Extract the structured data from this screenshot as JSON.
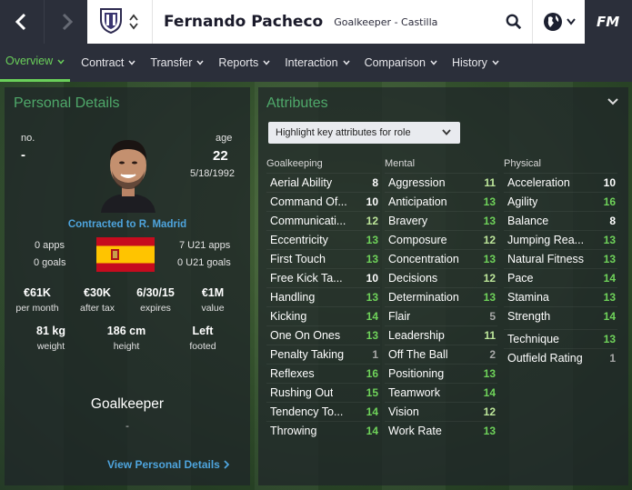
{
  "header": {
    "player_name": "Fernando Pacheco",
    "player_sub": "Goalkeeper - Castilla",
    "logo": "FM"
  },
  "menu": [
    {
      "label": "Overview",
      "active": true
    },
    {
      "label": "Contract",
      "active": false
    },
    {
      "label": "Transfer",
      "active": false
    },
    {
      "label": "Reports",
      "active": false
    },
    {
      "label": "Interaction",
      "active": false
    },
    {
      "label": "Comparison",
      "active": false
    },
    {
      "label": "History",
      "active": false
    }
  ],
  "personal": {
    "title": "Personal Details",
    "no_label": "no.",
    "no_value": "-",
    "age_label": "age",
    "age_value": "22",
    "dob": "5/18/1992",
    "contracted": "Contracted to R. Madrid",
    "apps": "0 apps",
    "goals": "0 goals",
    "u21_apps": "7 U21 apps",
    "u21_goals": "0 U21 goals",
    "wage_value": "€61K",
    "wage_label": "per month",
    "after_tax_value": "€30K",
    "after_tax_label": "after tax",
    "expires_value": "6/30/15",
    "expires_label": "expires",
    "value_value": "€1M",
    "value_label": "value",
    "weight_value": "81 kg",
    "weight_label": "weight",
    "height_value": "186 cm",
    "height_label": "height",
    "foot_value": "Left",
    "foot_label": "footed",
    "position": "Goalkeeper",
    "position_sub": "-",
    "view_link": "View Personal Details"
  },
  "attributes": {
    "title": "Attributes",
    "highlight": "Highlight key attributes for role",
    "colors": {
      "high": "#6fd35a",
      "mid": "#bde69a",
      "low": "#a8a8a8",
      "white": "#ffffff"
    },
    "columns": [
      {
        "heading": "Goalkeeping",
        "rows": [
          {
            "name": "Aerial Ability",
            "value": "8"
          },
          {
            "name": "Command Of...",
            "value": "10"
          },
          {
            "name": "Communicati...",
            "value": "12"
          },
          {
            "name": "Eccentricity",
            "value": "13"
          },
          {
            "name": "First Touch",
            "value": "13"
          },
          {
            "name": "Free Kick Ta...",
            "value": "10"
          },
          {
            "name": "Handling",
            "value": "13"
          },
          {
            "name": "Kicking",
            "value": "14"
          },
          {
            "name": "One On Ones",
            "value": "13"
          },
          {
            "name": "Penalty Taking",
            "value": "1"
          },
          {
            "name": "Reflexes",
            "value": "16"
          },
          {
            "name": "Rushing Out",
            "value": "15"
          },
          {
            "name": "Tendency To...",
            "value": "14"
          },
          {
            "name": "Throwing",
            "value": "14"
          }
        ]
      },
      {
        "heading": "Mental",
        "rows": [
          {
            "name": "Aggression",
            "value": "11"
          },
          {
            "name": "Anticipation",
            "value": "13"
          },
          {
            "name": "Bravery",
            "value": "13"
          },
          {
            "name": "Composure",
            "value": "12"
          },
          {
            "name": "Concentration",
            "value": "13"
          },
          {
            "name": "Decisions",
            "value": "12"
          },
          {
            "name": "Determination",
            "value": "13"
          },
          {
            "name": "Flair",
            "value": "5"
          },
          {
            "name": "Leadership",
            "value": "11"
          },
          {
            "name": "Off The Ball",
            "value": "2"
          },
          {
            "name": "Positioning",
            "value": "13"
          },
          {
            "name": "Teamwork",
            "value": "14"
          },
          {
            "name": "Vision",
            "value": "12"
          },
          {
            "name": "Work Rate",
            "value": "13"
          }
        ]
      },
      {
        "heading": "Physical",
        "rows": [
          {
            "name": "Acceleration",
            "value": "10"
          },
          {
            "name": "Agility",
            "value": "16"
          },
          {
            "name": "Balance",
            "value": "8"
          },
          {
            "name": "Jumping Rea...",
            "value": "13"
          },
          {
            "name": "Natural Fitness",
            "value": "13"
          },
          {
            "name": "Pace",
            "value": "14"
          },
          {
            "name": "Stamina",
            "value": "13"
          },
          {
            "name": "Strength",
            "value": "14"
          },
          {
            "name": "Technique",
            "value": "13"
          },
          {
            "name": "Outfield Rating",
            "value": "1"
          }
        ]
      }
    ]
  }
}
